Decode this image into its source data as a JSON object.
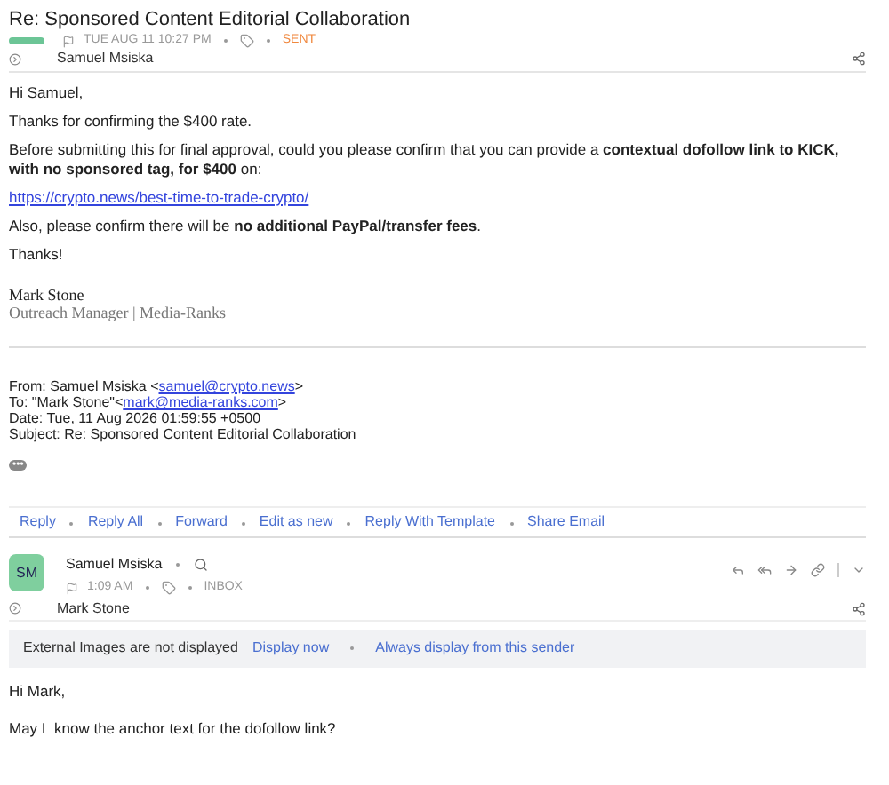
{
  "subject": "Re: Sponsored Content Editorial Collaboration",
  "message1": {
    "flagged": false,
    "time": "TUE AUG 11 10:27 PM",
    "folder": "SENT",
    "recipient": "Samuel Msiska",
    "body": [
      {
        "kind": "text",
        "text": "Hi Samuel,"
      },
      {
        "kind": "text",
        "text": "Thanks for confirming the $400 rate."
      },
      {
        "kind": "text",
        "text": "Before submitting this for final approval, could you please confirm that you can provide a **contextual dofollow link to KICK, with no sponsored tag, for $400** on:"
      },
      {
        "kind": "link",
        "text": "https://crypto.news/best-time-to-trade-crypto/"
      },
      {
        "kind": "text",
        "text": "Also, please confirm there will be **no additional PayPal/transfer fees**."
      },
      {
        "kind": "text",
        "text": "Thanks!"
      }
    ],
    "signature": {
      "name": "Mark Stone",
      "title": "Outreach Manager | Media-Ranks"
    },
    "quoted": [
      {
        "label": "From: Samuel Msiska <",
        "link": "samuel@crypto.news",
        "after": ">"
      },
      {
        "label": "To: \"Mark Stone\"<",
        "link": "mark@media-ranks.com",
        "after": ">"
      },
      {
        "label": "Date: Tue, 11 Aug 2026 01:59:55 +0500"
      },
      {
        "label": "Subject: Re: Sponsored Content Editorial Collaboration"
      }
    ],
    "more": "•••"
  },
  "actions": [
    "Reply",
    "Reply All",
    "Forward",
    "Edit as new",
    "Reply With Template",
    "Share Email"
  ],
  "message2": {
    "initials": "SM",
    "sender": "Samuel Msiska",
    "time": "1:09 AM",
    "folder": "INBOX",
    "recipient": "Mark Stone",
    "banner": {
      "text": "External Images are not displayed",
      "links": [
        "Display now",
        "Always display from this sender"
      ]
    },
    "body": [
      "Hi Mark,",
      "May I  know the anchor text for the dofollow link?"
    ]
  }
}
